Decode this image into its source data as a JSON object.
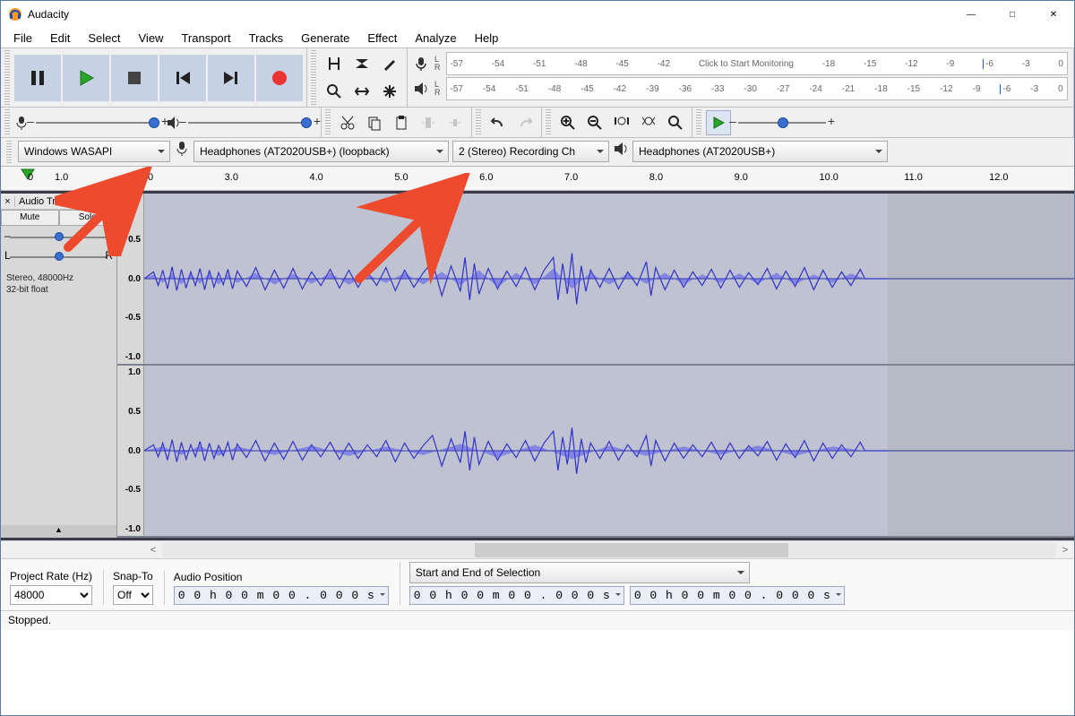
{
  "window": {
    "title": "Audacity"
  },
  "menu": [
    "File",
    "Edit",
    "Select",
    "View",
    "Transport",
    "Tracks",
    "Generate",
    "Effect",
    "Analyze",
    "Help"
  ],
  "transport": {
    "pause": "pause-icon",
    "play": "play-icon",
    "stop": "stop-icon",
    "skip_start": "skip-start-icon",
    "skip_end": "skip-end-icon",
    "record": "record-icon"
  },
  "meters": {
    "ticks": [
      "-57",
      "-54",
      "-51",
      "-48",
      "-45",
      "-42",
      "-39",
      "-36",
      "-33",
      "-30",
      "-27",
      "-24",
      "-21",
      "-18",
      "-15",
      "-12",
      "-9",
      "-6",
      "-3",
      "0"
    ],
    "rec_hint": "Click to Start Monitoring"
  },
  "device": {
    "host": "Windows WASAPI",
    "rec_device": "Headphones (AT2020USB+) (loopback)",
    "rec_channels": "2 (Stereo) Recording Ch",
    "play_device": "Headphones (AT2020USB+)"
  },
  "timeline": {
    "marks": [
      "0",
      "1.0",
      "2.0",
      "3.0",
      "4.0",
      "5.0",
      "6.0",
      "7.0",
      "8.0",
      "9.0",
      "10.0",
      "11.0",
      "12.0"
    ]
  },
  "track": {
    "name": "Audio Track",
    "mute": "Mute",
    "solo": "Solo",
    "pan_left": "L",
    "pan_right": "R",
    "info_line1": "Stereo, 48000Hz",
    "info_line2": "32-bit float",
    "vscale": [
      "1.0",
      "0.5",
      "0.0",
      "-0.5",
      "-1.0"
    ]
  },
  "selection": {
    "rate_label": "Project Rate (Hz)",
    "rate_value": "48000",
    "snap_label": "Snap-To",
    "snap_value": "Off",
    "pos_label": "Audio Position",
    "range_label": "Start and End of Selection",
    "time_zero": "0 0 h 0 0 m 0 0 . 0 0 0 s"
  },
  "status": {
    "text": "Stopped."
  }
}
